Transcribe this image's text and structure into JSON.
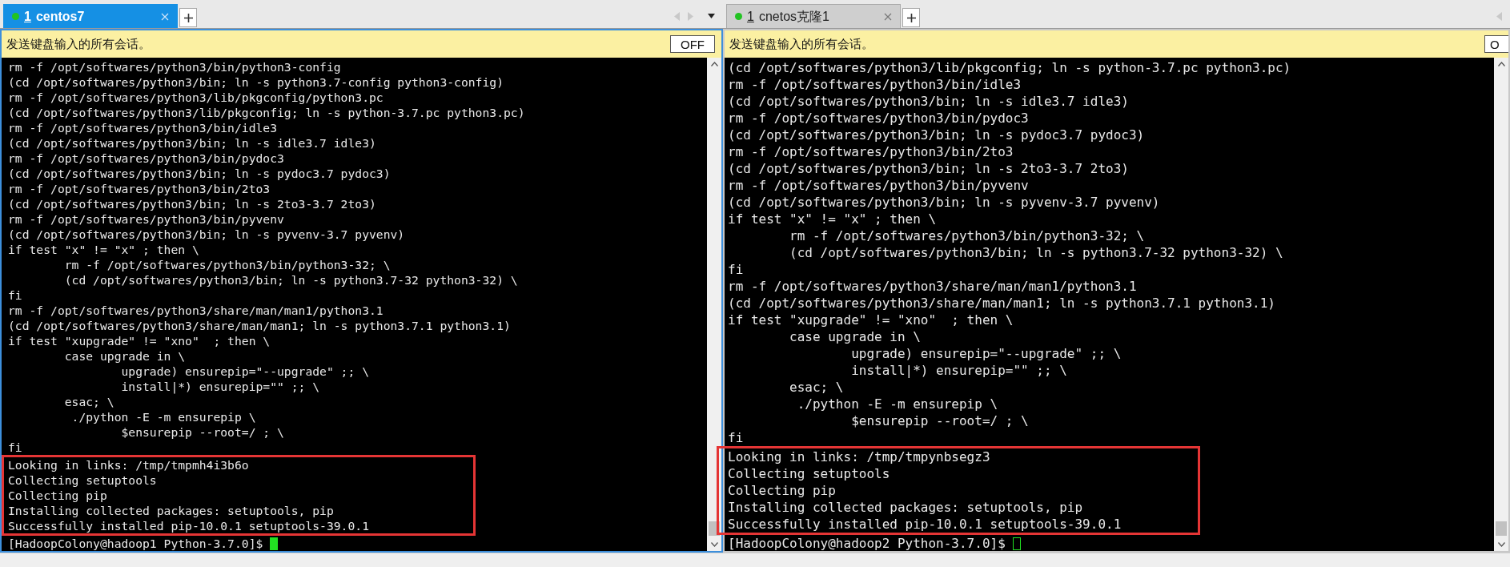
{
  "panes": [
    {
      "tab": {
        "number": "1",
        "label": "centos7",
        "selected": true
      },
      "broadcast": {
        "text": "发送键盘输入的所有会话。",
        "button": "OFF"
      },
      "lines": [
        "rm -f /opt/softwares/python3/bin/python3-config",
        "(cd /opt/softwares/python3/bin; ln -s python3.7-config python3-config)",
        "rm -f /opt/softwares/python3/lib/pkgconfig/python3.pc",
        "(cd /opt/softwares/python3/lib/pkgconfig; ln -s python-3.7.pc python3.pc)",
        "rm -f /opt/softwares/python3/bin/idle3",
        "(cd /opt/softwares/python3/bin; ln -s idle3.7 idle3)",
        "rm -f /opt/softwares/python3/bin/pydoc3",
        "(cd /opt/softwares/python3/bin; ln -s pydoc3.7 pydoc3)",
        "rm -f /opt/softwares/python3/bin/2to3",
        "(cd /opt/softwares/python3/bin; ln -s 2to3-3.7 2to3)",
        "rm -f /opt/softwares/python3/bin/pyvenv",
        "(cd /opt/softwares/python3/bin; ln -s pyvenv-3.7 pyvenv)",
        "if test \"x\" != \"x\" ; then \\",
        "        rm -f /opt/softwares/python3/bin/python3-32; \\",
        "        (cd /opt/softwares/python3/bin; ln -s python3.7-32 python3-32) \\",
        "fi",
        "rm -f /opt/softwares/python3/share/man/man1/python3.1",
        "(cd /opt/softwares/python3/share/man/man1; ln -s python3.7.1 python3.1)",
        "if test \"xupgrade\" != \"xno\"  ; then \\",
        "        case upgrade in \\",
        "                upgrade) ensurepip=\"--upgrade\" ;; \\",
        "                install|*) ensurepip=\"\" ;; \\",
        "        esac; \\",
        "         ./python -E -m ensurepip \\",
        "                $ensurepip --root=/ ; \\",
        "fi"
      ],
      "highlighted_lines": [
        "Looking in links: /tmp/tmpmh4i3b6o",
        "Collecting setuptools",
        "Collecting pip",
        "Installing collected packages: setuptools, pip",
        "Successfully installed pip-10.0.1 setuptools-39.0.1"
      ],
      "prompt": "[HadoopColony@hadoop1 Python-3.7.0]$ "
    },
    {
      "tab": {
        "number": "1",
        "label": "cnetos克隆1",
        "selected": false
      },
      "broadcast": {
        "text": "发送键盘输入的所有会话。",
        "button": "O"
      },
      "lines": [
        "(cd /opt/softwares/python3/lib/pkgconfig; ln -s python-3.7.pc python3.pc)",
        "rm -f /opt/softwares/python3/bin/idle3",
        "(cd /opt/softwares/python3/bin; ln -s idle3.7 idle3)",
        "rm -f /opt/softwares/python3/bin/pydoc3",
        "(cd /opt/softwares/python3/bin; ln -s pydoc3.7 pydoc3)",
        "rm -f /opt/softwares/python3/bin/2to3",
        "(cd /opt/softwares/python3/bin; ln -s 2to3-3.7 2to3)",
        "rm -f /opt/softwares/python3/bin/pyvenv",
        "(cd /opt/softwares/python3/bin; ln -s pyvenv-3.7 pyvenv)",
        "if test \"x\" != \"x\" ; then \\",
        "        rm -f /opt/softwares/python3/bin/python3-32; \\",
        "        (cd /opt/softwares/python3/bin; ln -s python3.7-32 python3-32) \\",
        "fi",
        "rm -f /opt/softwares/python3/share/man/man1/python3.1",
        "(cd /opt/softwares/python3/share/man/man1; ln -s python3.7.1 python3.1)",
        "if test \"xupgrade\" != \"xno\"  ; then \\",
        "        case upgrade in \\",
        "                upgrade) ensurepip=\"--upgrade\" ;; \\",
        "                install|*) ensurepip=\"\" ;; \\",
        "        esac; \\",
        "         ./python -E -m ensurepip \\",
        "                $ensurepip --root=/ ; \\",
        "fi"
      ],
      "highlighted_lines": [
        "Looking in links: /tmp/tmpynbsegz3",
        "Collecting setuptools",
        "Collecting pip",
        "Installing collected packages: setuptools, pip",
        "Successfully installed pip-10.0.1 setuptools-39.0.1"
      ],
      "prompt": "[HadoopColony@hadoop2 Python-3.7.0]$ "
    }
  ]
}
